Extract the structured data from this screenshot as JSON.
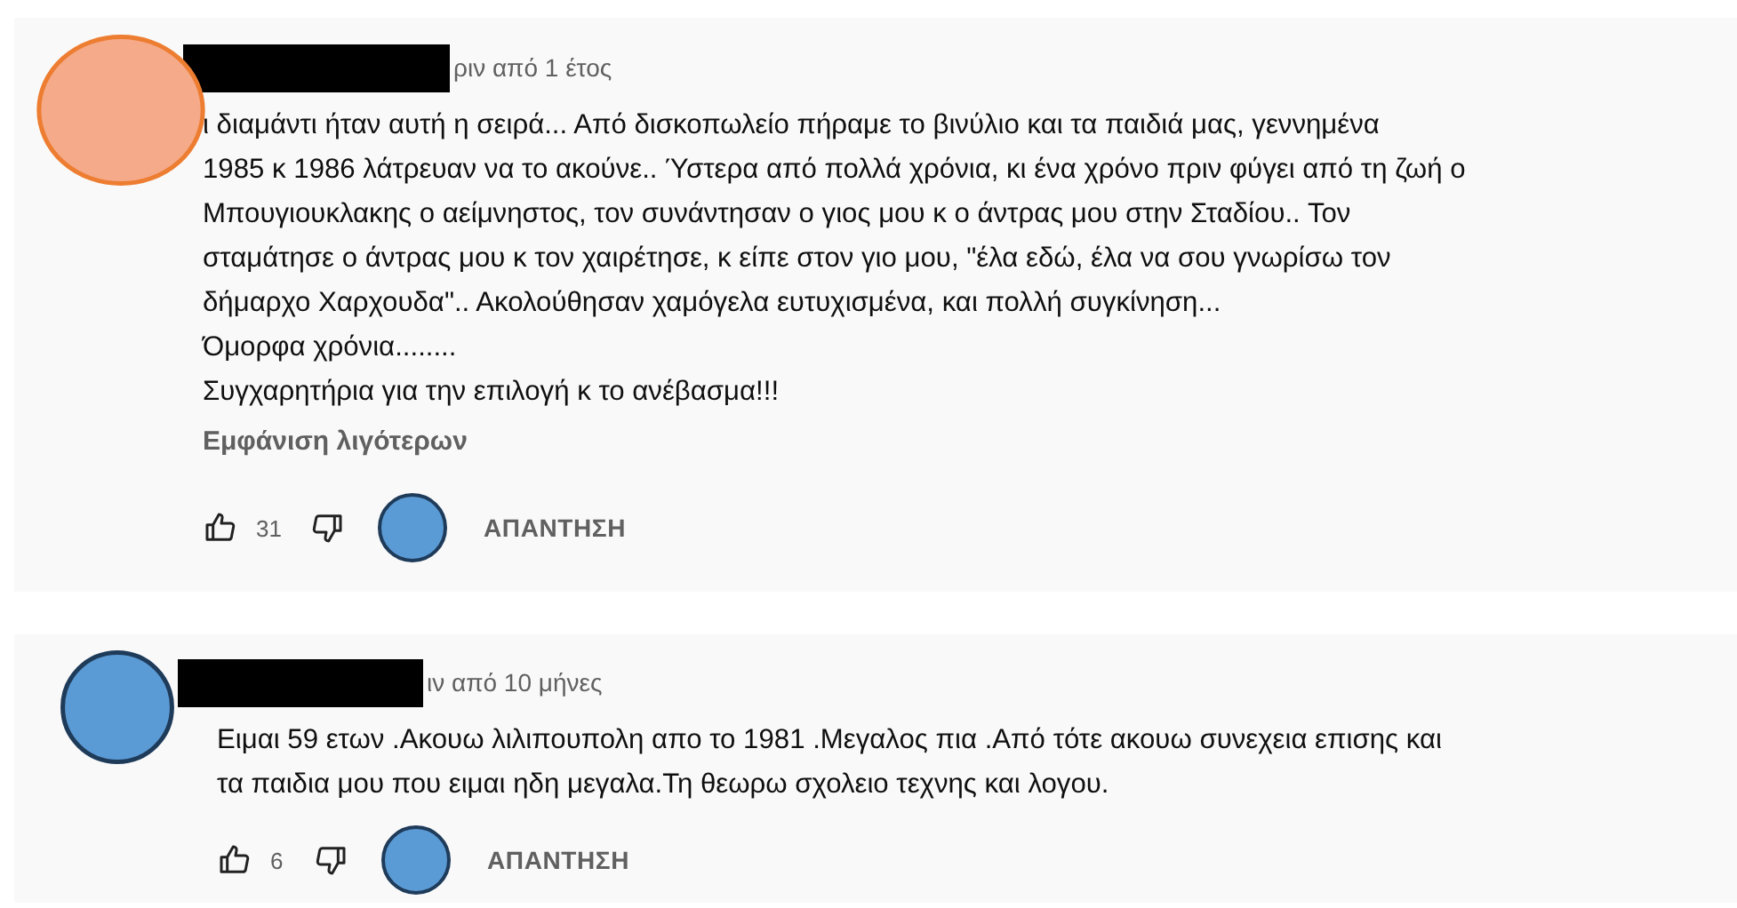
{
  "comments": [
    {
      "color": "#f5aa8a",
      "time": "ριν από 1 έτος",
      "lines": [
        "ι διαμάντι ήταν αυτή η σειρά... Από δισκοπωλείο πήραμε το βινύλιο και τα παιδιά μας, γεννημένα",
        "1985 κ 1986 λάτρευαν να το ακούνε.. Ύστερα από πολλά χρόνια, κι ένα χρόνο πριν φύγει από τη ζωή ο",
        "Μπουγιουκλακης ο αείμνηστος, τον συνάντησαν ο γιος μου κ ο άντρας μου στην Σταδίου.. Τον",
        "σταμάτησε ο άντρας μου κ τον χαιρέτησε, κ είπε στον γιο μου, \"έλα εδώ, έλα να σου γνωρίσω τον",
        "δήμαρχο Χαρχουδα\".. Ακολούθησαν χαμόγελα ευτυχισμένα, και πολλή συγκίνηση...",
        "Όμορφα χρόνια........",
        "Συγχαρητήρια για την επιλογή κ το ανέβασμα!!!"
      ],
      "show_less": "Εμφάνιση λιγότερων",
      "likes": "31",
      "reply": "ΑΠΑΝΤΗΣΗ"
    },
    {
      "color": "#5b9bd5",
      "time": "ιν από 10 μήνες",
      "lines": [
        "Ειμαι 59 ετων .Ακουω λιλιπουπολη απο το 1981 .Μεγαλος πια .Από τότε ακουω συνεχεια επισης και",
        "τα παιδια μου που ειμαι ηδη μεγαλα.Τη θεωρω σχολειο τεχνης και λογου."
      ],
      "likes": "6",
      "reply": "ΑΠΑΝΤΗΣΗ"
    }
  ]
}
